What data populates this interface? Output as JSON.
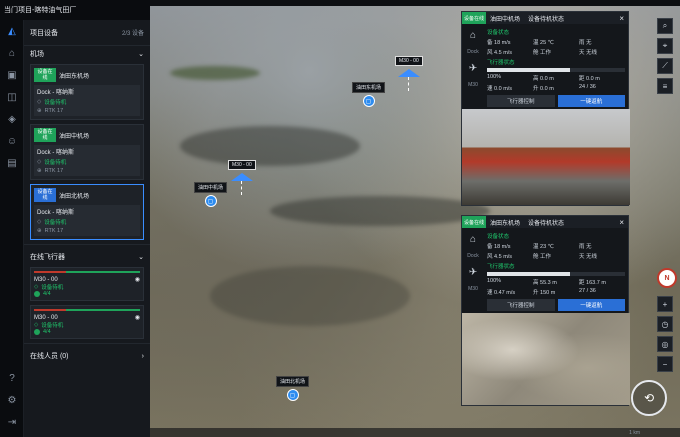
{
  "app": {
    "title": "当门项目-喀特油气田厂"
  },
  "rail": {
    "icons": [
      "project-icon",
      "device-icon",
      "media-icon",
      "map-icon",
      "model-icon",
      "member-icon",
      "task-icon"
    ],
    "bottom_icons": [
      "help-icon",
      "settings-icon",
      "logout-icon"
    ]
  },
  "sidebar": {
    "header_title": "项目设备",
    "header_meta": "2/3 设备",
    "docks_section": "机场",
    "docks": [
      {
        "badge": "设备在线",
        "name": "油田东机场",
        "drone": "Dock - 喀纳斯",
        "status": "设备待机",
        "extra": "RTK 17"
      },
      {
        "badge": "设备在线",
        "name": "油田中机场",
        "drone": "Dock - 喀纳斯",
        "status": "设备待机",
        "extra": "RTK 17"
      },
      {
        "badge": "设备在线",
        "name": "油田北机场",
        "drone": "Dock - 喀纳斯",
        "status": "设备待机",
        "extra": "RTK 17"
      }
    ],
    "online_section": "在线飞行器",
    "online": [
      {
        "name": "M30 - 00",
        "status": "设备待机",
        "extra": "4/4"
      },
      {
        "name": "M30 - 00",
        "status": "设备待机",
        "extra": "4/4"
      }
    ],
    "members_section": "在线人员 (0)"
  },
  "map": {
    "docks": [
      {
        "label": "油田东机场"
      },
      {
        "label": "油田中机场"
      },
      {
        "label": "油田北机场"
      }
    ],
    "drones": [
      {
        "label": "M30 - 00"
      },
      {
        "label": "M30 - 00"
      }
    ]
  },
  "panels": [
    {
      "badge": "设备在线",
      "title": "油田中机场",
      "subtitle": "设备待机状态",
      "dock_label": "Dock",
      "tag1": "设备状态",
      "stats1": [
        "备 18 m/s",
        "温 25 ℃",
        "雨 无"
      ],
      "stats2": [
        "风 4.5 m/s",
        "舱 工作",
        "天 无线"
      ],
      "tag2": "飞行器状态",
      "stats3": [
        "100%",
        "高 0.0 m",
        "距 0.0 m"
      ],
      "stats4": [
        "速 0.0 m/s",
        "升 0.0 m",
        "24 / 36"
      ],
      "actions": [
        "飞行器控制",
        "一键返航"
      ],
      "m30_label": "M30"
    },
    {
      "badge": "设备在线",
      "title": "油田东机场",
      "subtitle": "设备待机状态",
      "dock_label": "Dock",
      "tag1": "设备状态",
      "stats1": [
        "备 18 m/s",
        "温 23 ℃",
        "雨 无"
      ],
      "stats2": [
        "风 4.5 m/s",
        "舱 工作",
        "天 无线"
      ],
      "tag2": "飞行器状态",
      "stats3": [
        "100%",
        "高 55.3 m",
        "距 163.7 m"
      ],
      "stats4": [
        "速 0.47 m/s",
        "升 150 m",
        "27 / 36"
      ],
      "actions": [
        "飞行器控制",
        "一键返航"
      ],
      "m30_label": "M30"
    }
  ],
  "right_tools": [
    "search-icon",
    "locate-icon",
    "measure-icon",
    "layer-icon"
  ],
  "compass_label": "N",
  "zoom_tools": [
    "zoom-in-icon",
    "clock-icon",
    "target-icon",
    "zoom-out-icon"
  ],
  "statusbar": "1 km"
}
